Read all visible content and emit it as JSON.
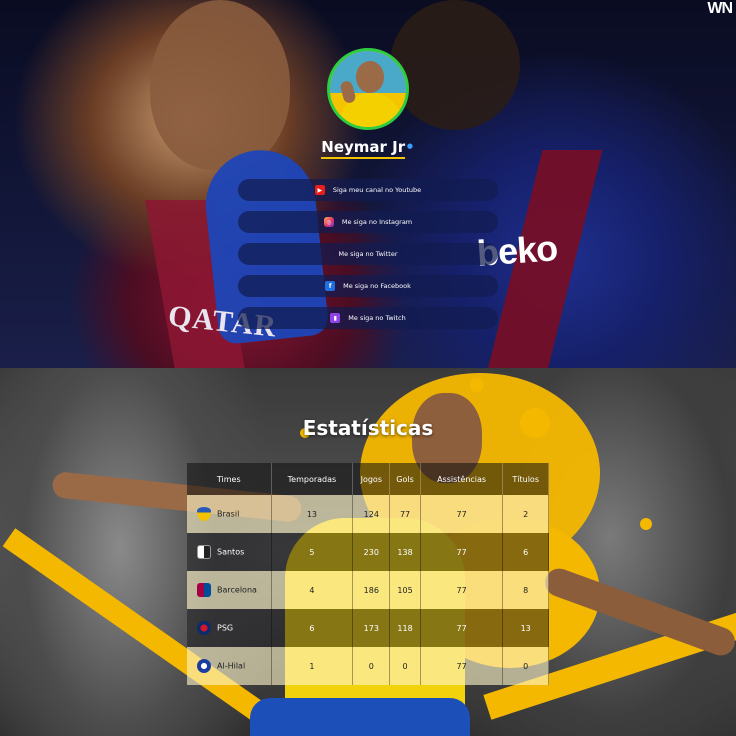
{
  "corner_logo": "WN",
  "profile": {
    "name": "Neymar Jr",
    "name_dot": "•",
    "avatar_alt": "Neymar profile photo"
  },
  "hero_text": {
    "sponsor": "beko",
    "shirt_text": "QATAR"
  },
  "links": [
    {
      "label": "Siga meu canal no Youtube",
      "icon": "youtube-icon",
      "color": "#e61e1e"
    },
    {
      "label": "Me siga no Instagram",
      "icon": "instagram-icon",
      "color": "#e1306c"
    },
    {
      "label": "Me siga no Twitter",
      "icon": "twitter-icon",
      "color": ""
    },
    {
      "label": "Me siga no Facebook",
      "icon": "facebook-icon",
      "color": "#1f6fe0"
    },
    {
      "label": "Me siga no Twitch",
      "icon": "twitch-icon",
      "color": "#8e44e8"
    }
  ],
  "stats": {
    "title": "Estatísticas",
    "headers": [
      "Times",
      "Temporadas",
      "Jogos",
      "Gols",
      "Assistências",
      "Títulos"
    ],
    "rows": [
      {
        "team": "Brasil",
        "crest": "brasil-crest-icon",
        "temporadas": "13",
        "jogos": "124",
        "gols": "77",
        "assistencias": "77",
        "titulos": "2"
      },
      {
        "team": "Santos",
        "crest": "santos-crest-icon",
        "temporadas": "5",
        "jogos": "230",
        "gols": "138",
        "assistencias": "77",
        "titulos": "6"
      },
      {
        "team": "Barcelona",
        "crest": "barcelona-crest-icon",
        "temporadas": "4",
        "jogos": "186",
        "gols": "105",
        "assistencias": "77",
        "titulos": "8"
      },
      {
        "team": "PSG",
        "crest": "psg-crest-icon",
        "temporadas": "6",
        "jogos": "173",
        "gols": "118",
        "assistencias": "77",
        "titulos": "13"
      },
      {
        "team": "Al-Hilal",
        "crest": "alhilal-crest-icon",
        "temporadas": "1",
        "jogos": "0",
        "gols": "0",
        "assistencias": "77",
        "titulos": "0"
      }
    ]
  },
  "colors": {
    "accent_yellow": "#f5b800",
    "avatar_ring": "#2ecc40",
    "link_bg": "#121c50"
  }
}
